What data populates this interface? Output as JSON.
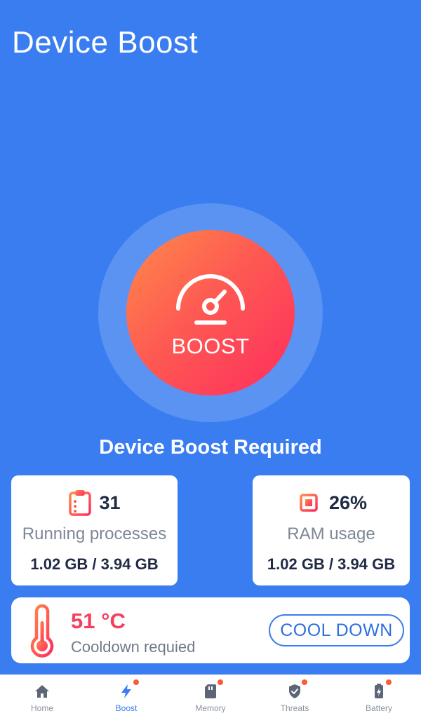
{
  "header": {
    "title": "Device Boost"
  },
  "boost": {
    "button_label": "BOOST",
    "status": "Device Boost Required"
  },
  "processes_card": {
    "value": "31",
    "label": "Running processes",
    "memory": "1.02 GB / 3.94 GB"
  },
  "ram_card": {
    "value": "26%",
    "label": "RAM usage",
    "memory": "1.02 GB / 3.94 GB"
  },
  "temperature_card": {
    "value": "51 °C",
    "label": "Cooldown requied",
    "button_label": "COOL DOWN"
  },
  "nav": {
    "items": [
      {
        "label": "Home",
        "icon": "home-icon",
        "active": false,
        "badge": false
      },
      {
        "label": "Boost",
        "icon": "lightning-icon",
        "active": true,
        "badge": true
      },
      {
        "label": "Memory",
        "icon": "sd-card-icon",
        "active": false,
        "badge": true
      },
      {
        "label": "Threats",
        "icon": "shield-icon",
        "active": false,
        "badge": true
      },
      {
        "label": "Battery",
        "icon": "battery-icon",
        "active": false,
        "badge": true
      }
    ]
  },
  "colors": {
    "background": "#3a7df0",
    "boost_gradient_start": "#ff8a4a",
    "boost_gradient_end": "#ff2d5e",
    "alert": "#f43f5e",
    "badge": "#ff5a36"
  }
}
